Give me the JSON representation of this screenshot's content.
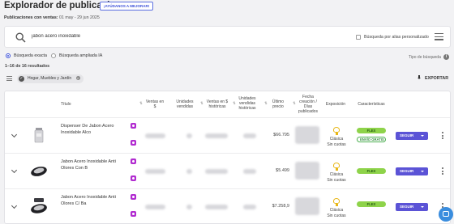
{
  "header": {
    "title": "Explorador de publicaciones",
    "help_button": "¡AYÚDANOS A MEJORAR!",
    "date_label": "Publicaciones con ventas:",
    "date_range": "01 may - 29 jun 2025"
  },
  "search": {
    "query": "jabon acero inoxidable",
    "alias_label": "Búsqueda por alias personalizado"
  },
  "search_mode": {
    "options": [
      "Búsqueda exacta",
      "Búsqueda ampliada IA"
    ],
    "selected": "Búsqueda exacta",
    "type_label": "Tipo de búsqueda"
  },
  "results": {
    "count_text": "1–16 de 16 resultados"
  },
  "filters": {
    "category_chip": "Hogar, Muebles y Jardín",
    "export_label": "EXPORTAR"
  },
  "table": {
    "columns": {
      "title": "Título",
      "sales": "Ventas en $",
      "units": "Unidades vendidas",
      "sales_hist": "Ventas en $ históricas",
      "units_hist": "Unidades vendidas históricas",
      "last_price": "Último precio",
      "created": "Fecha creación / Días publicados",
      "exposure": "Exposición",
      "features": "Características"
    },
    "rows": [
      {
        "title": "Dispenser De Jabon Acero Inoxidable Alco",
        "price": "$66.795",
        "exposure_type": "Clásica",
        "installments": "Sin cuotas",
        "badges": [
          "FLEX",
          "ENVÍO GRATIS"
        ],
        "follow_label": "SEGUIR"
      },
      {
        "title": "Jabon Acero Inoxidable Anti Olores Con B",
        "price": "$5.499",
        "exposure_type": "Clásica",
        "installments": "Sin cuotas",
        "badges": [
          "FLEX"
        ],
        "follow_label": "SEGUIR"
      },
      {
        "title": "Jabon Acero Inoxidable Anti Olores C/ Ba",
        "price": "$7.258,9",
        "exposure_type": "Clásica",
        "installments": "Sin cuotas",
        "badges": [
          "FLEX"
        ],
        "follow_label": "SEGUIR"
      }
    ]
  },
  "colors": {
    "accent": "#5b53d6",
    "flex_badge": "#8ed34a",
    "extension_icon": "#b12bd0",
    "chat_button": "#3a8dde"
  }
}
